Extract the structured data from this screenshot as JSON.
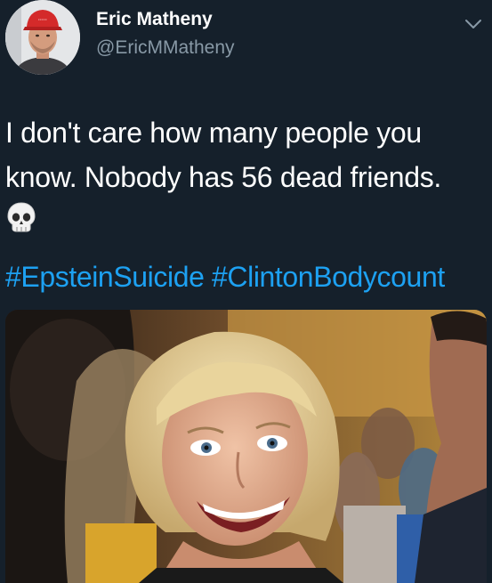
{
  "author": {
    "display_name": "Eric Matheny",
    "handle": "@EricMMatheny",
    "avatar_icon": "profile-photo-red-cap"
  },
  "tweet": {
    "lines": [
      "I don't care how many people you",
      "know. Nobody has 56 dead friends."
    ],
    "emoji": "skull-emoji",
    "hashtags": [
      "#EpsteinSuicide",
      "#ClintonBodycount"
    ]
  },
  "media": {
    "type": "photo",
    "description_icon": "smiling-woman-crowd-photo"
  },
  "colors": {
    "background": "#15202b",
    "text": "#ffffff",
    "secondary": "#8899a6",
    "link": "#1da1f2"
  }
}
